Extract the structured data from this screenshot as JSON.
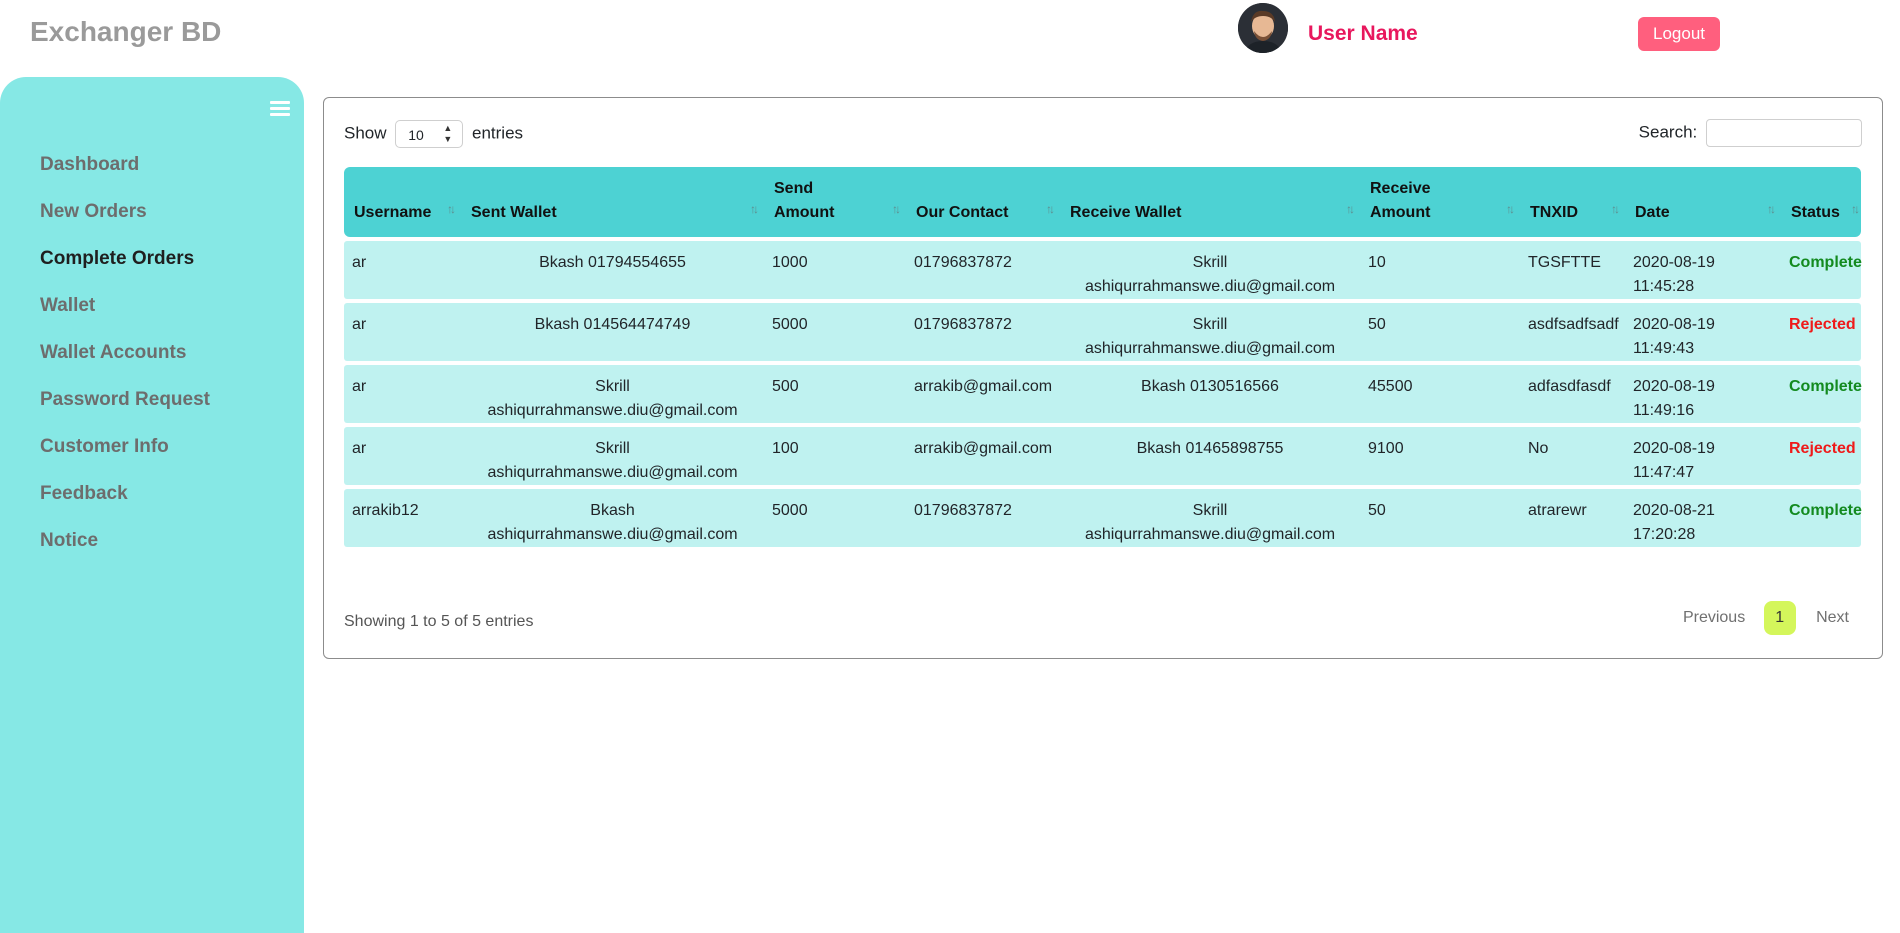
{
  "header": {
    "brand": "Exchanger BD",
    "username": "User Name",
    "logout_label": "Logout"
  },
  "sidebar": {
    "items": [
      {
        "label": "Dashboard",
        "active": false
      },
      {
        "label": "New Orders",
        "active": false
      },
      {
        "label": "Complete Orders",
        "active": true
      },
      {
        "label": "Wallet",
        "active": false
      },
      {
        "label": "Wallet Accounts",
        "active": false
      },
      {
        "label": "Password Request",
        "active": false
      },
      {
        "label": "Customer Info",
        "active": false
      },
      {
        "label": "Feedback",
        "active": false
      },
      {
        "label": "Notice",
        "active": false
      }
    ]
  },
  "table_controls": {
    "show_label": "Show",
    "entries_value": "10",
    "entries_label": "entries",
    "search_label": "Search:",
    "search_value": ""
  },
  "table": {
    "columns": [
      "Username",
      "Sent Wallet",
      "Send Amount",
      "Our Contact",
      "Receive Wallet",
      "Receive Amount",
      "TNXID",
      "Date",
      "Status"
    ],
    "rows": [
      {
        "username": "ar",
        "sent_wallet": "Bkash 01794554655",
        "send_amount": "1000",
        "our_contact": "01796837872",
        "receive_wallet": "Skrill ashiqurrahmanswe.diu@gmail.com",
        "receive_amount": "10",
        "tnxid": "TGSFTTE",
        "date": "2020-08-19 11:45:28",
        "status": "Complete"
      },
      {
        "username": "ar",
        "sent_wallet": "Bkash 014564474749",
        "send_amount": "5000",
        "our_contact": "01796837872",
        "receive_wallet": "Skrill ashiqurrahmanswe.diu@gmail.com",
        "receive_amount": "50",
        "tnxid": "asdfsadfsadf",
        "date": "2020-08-19 11:49:43",
        "status": "Rejected"
      },
      {
        "username": "ar",
        "sent_wallet": "Skrill ashiqurrahmanswe.diu@gmail.com",
        "send_amount": "500",
        "our_contact": "arrakib@gmail.com",
        "receive_wallet": "Bkash 0130516566",
        "receive_amount": "45500",
        "tnxid": "adfasdfasdf",
        "date": "2020-08-19 11:49:16",
        "status": "Complete"
      },
      {
        "username": "ar",
        "sent_wallet": "Skrill ashiqurrahmanswe.diu@gmail.com",
        "send_amount": "100",
        "our_contact": "arrakib@gmail.com",
        "receive_wallet": "Bkash 01465898755",
        "receive_amount": "9100",
        "tnxid": "No",
        "date": "2020-08-19 11:47:47",
        "status": "Rejected"
      },
      {
        "username": "arrakib12",
        "sent_wallet": "Bkash ashiqurrahmanswe.diu@gmail.com",
        "send_amount": "5000",
        "our_contact": "01796837872",
        "receive_wallet": "Skrill ashiqurrahmanswe.diu@gmail.com",
        "receive_amount": "50",
        "tnxid": "atrarewr",
        "date": "2020-08-21 17:20:28",
        "status": "Complete"
      }
    ]
  },
  "footer": {
    "info": "Showing 1 to 5 of 5 entries",
    "previous_label": "Previous",
    "current_page": "1",
    "next_label": "Next"
  },
  "colors": {
    "sidebar_bg": "#86e8e5",
    "table_header_bg": "#4dd2d3",
    "row_bg": "#bff2f0",
    "accent_pink": "#e8175d",
    "status_complete": "#138a1f",
    "status_rejected": "#ef1a1a",
    "pager_active": "#d4f65b"
  },
  "icons": {
    "menu": "hamburger-menu-icon",
    "sort": "sort-arrows-icon",
    "select_arrows": "select-arrows-icon"
  }
}
